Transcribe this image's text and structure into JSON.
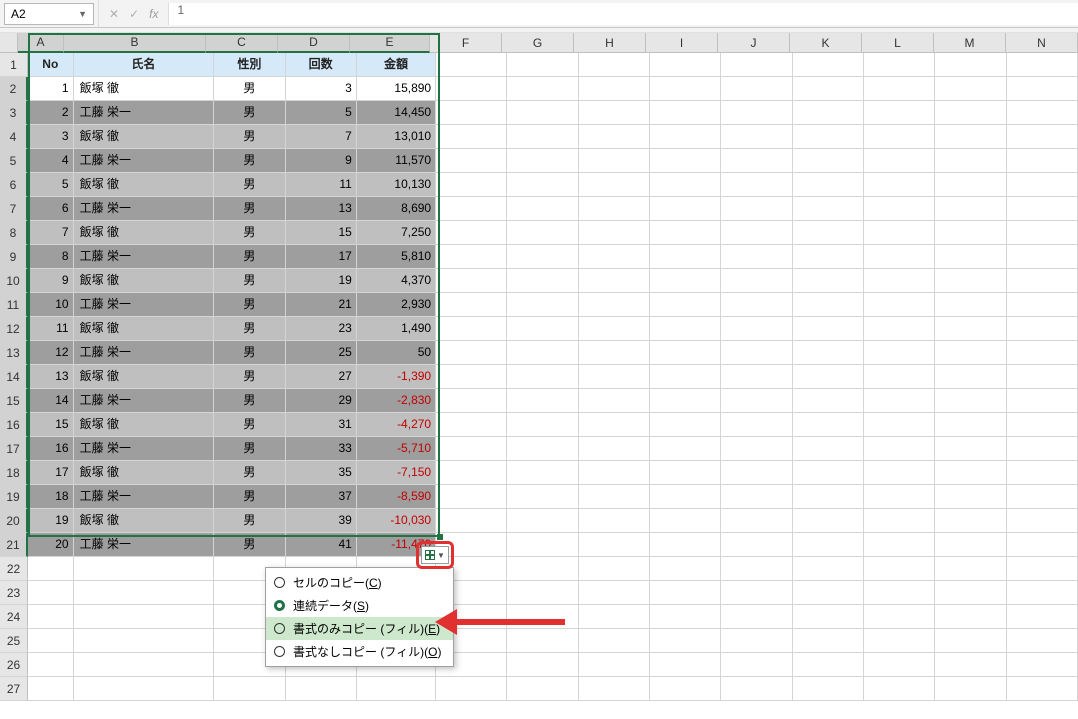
{
  "formula_bar": {
    "name_box": "A2",
    "formula": "1"
  },
  "columns": [
    {
      "letter": "A",
      "width": 46
    },
    {
      "letter": "B",
      "width": 142
    },
    {
      "letter": "C",
      "width": 72
    },
    {
      "letter": "D",
      "width": 72
    },
    {
      "letter": "E",
      "width": 80
    },
    {
      "letter": "F",
      "width": 72
    },
    {
      "letter": "G",
      "width": 72
    },
    {
      "letter": "H",
      "width": 72
    },
    {
      "letter": "I",
      "width": 72
    },
    {
      "letter": "J",
      "width": 72
    },
    {
      "letter": "K",
      "width": 72
    },
    {
      "letter": "L",
      "width": 72
    },
    {
      "letter": "M",
      "width": 72
    },
    {
      "letter": "N",
      "width": 72
    }
  ],
  "selected_cols": [
    "A",
    "B",
    "C",
    "D",
    "E"
  ],
  "row_count": 27,
  "selected_rows_from": 2,
  "selected_rows_to": 21,
  "table": {
    "headers": {
      "no": "No",
      "name": "氏名",
      "gender": "性別",
      "count": "回数",
      "amount": "金額"
    },
    "rows": [
      {
        "no": "1",
        "name": "飯塚 徹",
        "gender": "男",
        "count": "3",
        "amount": "15,890"
      },
      {
        "no": "2",
        "name": "工藤 栄一",
        "gender": "男",
        "count": "5",
        "amount": "14,450"
      },
      {
        "no": "3",
        "name": "飯塚 徹",
        "gender": "男",
        "count": "7",
        "amount": "13,010"
      },
      {
        "no": "4",
        "name": "工藤 栄一",
        "gender": "男",
        "count": "9",
        "amount": "11,570"
      },
      {
        "no": "5",
        "name": "飯塚 徹",
        "gender": "男",
        "count": "11",
        "amount": "10,130"
      },
      {
        "no": "6",
        "name": "工藤 栄一",
        "gender": "男",
        "count": "13",
        "amount": "8,690"
      },
      {
        "no": "7",
        "name": "飯塚 徹",
        "gender": "男",
        "count": "15",
        "amount": "7,250"
      },
      {
        "no": "8",
        "name": "工藤 栄一",
        "gender": "男",
        "count": "17",
        "amount": "5,810"
      },
      {
        "no": "9",
        "name": "飯塚 徹",
        "gender": "男",
        "count": "19",
        "amount": "4,370"
      },
      {
        "no": "10",
        "name": "工藤 栄一",
        "gender": "男",
        "count": "21",
        "amount": "2,930"
      },
      {
        "no": "11",
        "name": "飯塚 徹",
        "gender": "男",
        "count": "23",
        "amount": "1,490"
      },
      {
        "no": "12",
        "name": "工藤 栄一",
        "gender": "男",
        "count": "25",
        "amount": "50"
      },
      {
        "no": "13",
        "name": "飯塚 徹",
        "gender": "男",
        "count": "27",
        "amount": "-1,390"
      },
      {
        "no": "14",
        "name": "工藤 栄一",
        "gender": "男",
        "count": "29",
        "amount": "-2,830"
      },
      {
        "no": "15",
        "name": "飯塚 徹",
        "gender": "男",
        "count": "31",
        "amount": "-4,270"
      },
      {
        "no": "16",
        "name": "工藤 栄一",
        "gender": "男",
        "count": "33",
        "amount": "-5,710"
      },
      {
        "no": "17",
        "name": "飯塚 徹",
        "gender": "男",
        "count": "35",
        "amount": "-7,150"
      },
      {
        "no": "18",
        "name": "工藤 栄一",
        "gender": "男",
        "count": "37",
        "amount": "-8,590"
      },
      {
        "no": "19",
        "name": "飯塚 徹",
        "gender": "男",
        "count": "39",
        "amount": "-10,030"
      },
      {
        "no": "20",
        "name": "工藤 栄一",
        "gender": "男",
        "count": "41",
        "amount": "-11,470"
      }
    ]
  },
  "autofill_menu": {
    "items": [
      {
        "label": "セルのコピー(C)",
        "selected": false
      },
      {
        "label": "連続データ(S)",
        "selected": true
      },
      {
        "label": "書式のみコピー (フィル)(E)",
        "selected": false,
        "highlight": true
      },
      {
        "label": "書式なしコピー (フィル)(O)",
        "selected": false
      }
    ]
  }
}
